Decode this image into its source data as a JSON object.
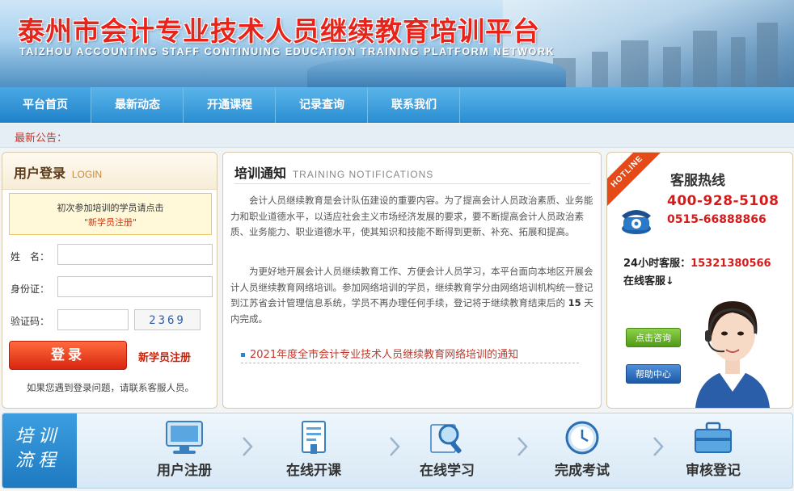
{
  "banner": {
    "title": "泰州市会计专业技术人员继续教育培训平台",
    "subtitle": "TAIZHOU ACCOUNTING STAFF CONTINUING EDUCATION TRAINING PLATFORM NETWORK"
  },
  "nav": {
    "items": [
      "平台首页",
      "最新动态",
      "开通课程",
      "记录查询",
      "联系我们"
    ]
  },
  "notice": {
    "label": "最新公告："
  },
  "login": {
    "title": "用户登录",
    "title_en": "LOGIN",
    "tip_line": "初次参加培训的学员请点击",
    "tip_link": "\"新学员注册\"",
    "name_label": "姓　名：",
    "id_label": "身份证：",
    "captcha_label": "验证码：",
    "captcha_code": "2369",
    "name_value": "",
    "id_value": "",
    "captcha_value": "",
    "login_button": "登录",
    "register_link": "新学员注册",
    "help_text": "如果您遇到登录问题，请联系客服人员。"
  },
  "training": {
    "title": "培训通知",
    "title_en": "TRAINING NOTIFICATIONS",
    "para1": "会计人员继续教育是会计队伍建设的重要内容。为了提高会计人员政治素质、业务能力和职业道德水平，以适应社会主义市场经济发展的要求，要不断提高会计人员政治素质、业务能力、职业道德水平，使其知识和技能不断得到更新、补充、拓展和提高。",
    "para2_a": "为更好地开展会计人员继续教育工作、方便会计人员学习，本平台面向本地区开展会计人员继续教育网络培训。参加网络培训的学员，继续教育学分由网络培训机构统一登记到江苏省会计管理信息系统，学员不再办理任何手续，登记将于继续教育结束后的",
    "para2_days": "15",
    "para2_b": "天内完成。",
    "news": "2021年度全市会计专业技术人员继续教育网络培训的通知"
  },
  "hotline": {
    "ribbon": "HOTLINE",
    "title": "客服热线",
    "tel1": "400-928-5108",
    "tel2": "0515-66888866",
    "h24_label": "24小时客服：",
    "h24_number": "15321380566",
    "online": "在线客服↓",
    "consult_button": "点击咨询",
    "help_button": "帮助中心"
  },
  "flow": {
    "tag_line1": "培训",
    "tag_line2": "流程",
    "steps": [
      "用户注册",
      "在线开课",
      "在线学习",
      "完成考试",
      "审核登记"
    ]
  },
  "colors": {
    "brand_red": "#e8231a",
    "nav_blue": "#2b8fd3",
    "accent_orange": "#d8260f"
  }
}
